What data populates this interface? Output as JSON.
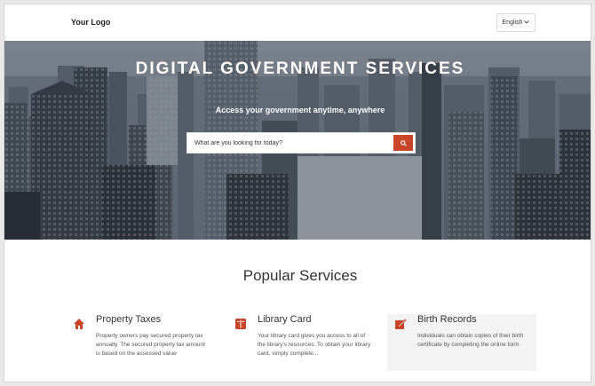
{
  "header": {
    "logo": "Your Logo",
    "language": "English",
    "language_icon": "chevron-down-icon"
  },
  "hero": {
    "title": "DIGITAL GOVERNMENT SERVICES",
    "subtitle": "Access your government anytime, anywhere",
    "search_placeholder": "What are you looking for today?",
    "search_icon": "search-icon"
  },
  "popular": {
    "title": "Popular Services",
    "services": [
      {
        "icon": "house-icon",
        "title": "Property Taxes",
        "description": "Property owners pay secured property tax annually. The secured property tax amount is based on the assessed value"
      },
      {
        "icon": "book-icon",
        "title": "Library Card",
        "description": "Your library card gives you access to all of the library's resources. To obtain your library card, simply complete..."
      },
      {
        "icon": "certificate-edit-icon",
        "title": "Birth Records",
        "description": "Individuals can obtain copies of their birth certificate by completing the online form"
      }
    ]
  },
  "colors": {
    "accent": "#c9452a"
  }
}
